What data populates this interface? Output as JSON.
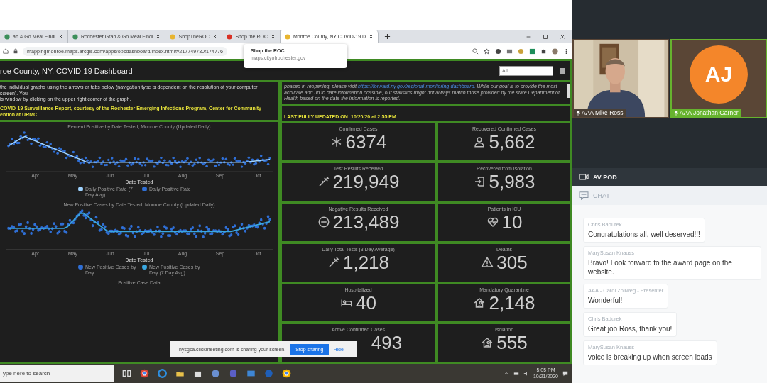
{
  "browser": {
    "tabs": [
      {
        "label": "ab & Go Meal Findi",
        "color": "#3c8f5a",
        "selected": false
      },
      {
        "label": "Rochester Grab & Go Meal Findi",
        "color": "#3c8f5a",
        "selected": false
      },
      {
        "label": "ShopTheROC",
        "color": "#e8b530",
        "selected": false
      },
      {
        "label": "Shop the ROC",
        "color": "#d93025",
        "selected": false
      },
      {
        "label": "Monroe County, NY COVID-19 D",
        "color": "#e8b530",
        "selected": true
      }
    ],
    "address": "mappingmonroe.maps.arcgis.com/apps/opsdashboard/index.html#/217749730f174776",
    "tooltip": {
      "title": "Shop the ROC",
      "url": "maps.cityofrochester.gov"
    }
  },
  "dashboard": {
    "title": "roe County, NY, COVID-19 Dashboard",
    "filter": "All",
    "intro": [
      "the individual graphs using the arrows or tabs below (navigation type is dependent on the resolution of your computer screen). You",
      "is window by clicking on the upper right corner of the graph."
    ],
    "source": [
      "COVID-19 Surveillance Report, courtesy of the Rochester Emerging Infections Program, Center for Community",
      "ention at URMC"
    ],
    "notice": {
      "before": "phased in reopening, please visit",
      "link": "https://forward.ny.gov/regional-monitoring-dashboard.",
      "after": "While our goal is to provide the most accurate and up to date information possible, our statistics might not always match those provided by the state Department of Health based on the date the information is reported."
    },
    "updated": "LAST FULLY UPDATED ON: 10/20/20 at 2:55 PM",
    "charts": [
      {
        "title": "Percent Positive by Date Tested, Monroe County (Updated Daily)",
        "months": [
          "Apr",
          "May",
          "Jun",
          "Jul",
          "Aug",
          "Sep",
          "Oct"
        ],
        "xlabel": "Date Tested",
        "legend": [
          {
            "label": "Daily Positive Rate (7 Day Avg)",
            "color": "#9fd3ff"
          },
          {
            "label": "Daily Positive Rate",
            "color": "#2f6fd6"
          }
        ]
      },
      {
        "title": "New Positive Cases by Date Tested, Monroe County (Updated Daily)",
        "months": [
          "Apr",
          "May",
          "Jun",
          "Jul",
          "Aug",
          "Sep",
          "Oct"
        ],
        "xlabel": "Date Tested",
        "legend": [
          {
            "label": "New Positive Cases by Day",
            "color": "#2f6fd6"
          },
          {
            "label": "New Positive Cases by Day (7 Day Avg)",
            "color": "#3aa7e0"
          }
        ]
      }
    ],
    "panel_label": "Positive Case Data",
    "stats": [
      {
        "label": "Confirmed Cases",
        "value": "6374"
      },
      {
        "label": "Recovered Confirmed Cases",
        "value": "5,662"
      },
      {
        "label": "Test Results Received",
        "value": "219,949"
      },
      {
        "label": "Recovered from Isolation",
        "value": "5,983"
      },
      {
        "label": "Negative Results Received",
        "value": "213,489"
      },
      {
        "label": "Patients in ICU",
        "value": "10"
      },
      {
        "label": "Daily Total Tests (3 Day Average)",
        "value": "1,218"
      },
      {
        "label": "Deaths",
        "value": "305"
      },
      {
        "label": "Hospitalized",
        "value": "40"
      },
      {
        "label": "Mandatory Quarantine",
        "value": "2,148"
      },
      {
        "label": "Active Confirmed Cases",
        "value": "493"
      },
      {
        "label": "Isolation",
        "value": "555"
      }
    ]
  },
  "share_bar": {
    "message": "nysgsa.clickmeeting.com is sharing your screen.",
    "stop": "Stop sharing",
    "hide": "Hide"
  },
  "taskbar": {
    "search_placeholder": "ype here to search",
    "time": "5:05 PM",
    "date": "10/21/2020"
  },
  "meeting": {
    "participants": [
      {
        "name": "AAA Mike Ross",
        "kind": "video",
        "speaking": false
      },
      {
        "name": "AAA Jonathan Garner",
        "kind": "avatar",
        "initials": "AJ",
        "speaking": true
      }
    ],
    "av_pod": "AV POD",
    "chat_title": "CHAT",
    "messages": [
      {
        "author": "Chris Badurek",
        "text": "Congratulations all, well deserved!!!"
      },
      {
        "author": "MarySusan Knauss",
        "text": "Bravo! Look forward to the award page on the website."
      },
      {
        "author": "AAA - Carol Zollweg - Presenter",
        "text": "Wonderful!"
      },
      {
        "author": "Chris Badurek",
        "text": "Great job Ross, thank you!"
      },
      {
        "author": "MarySusan Knauss",
        "text": "voice is breaking up when screen loads"
      }
    ]
  }
}
